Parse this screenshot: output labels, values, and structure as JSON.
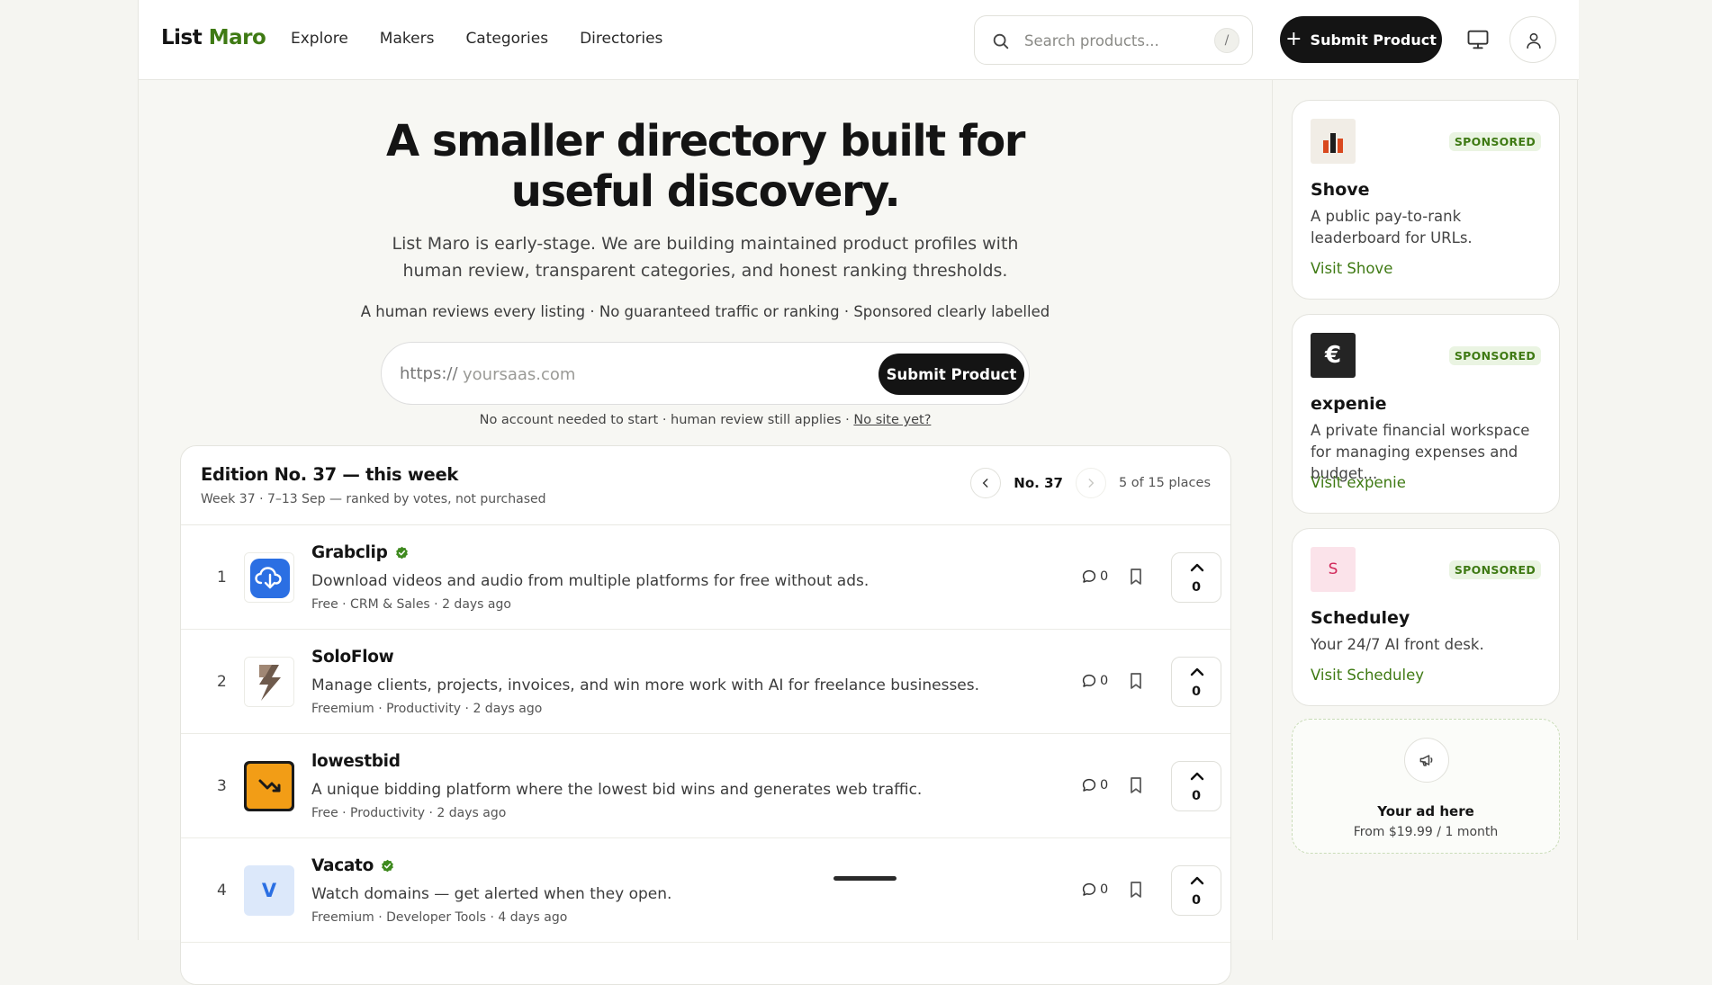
{
  "header": {
    "logo_part1": "List",
    "logo_part2": "Maro",
    "nav": [
      "Explore",
      "Makers",
      "Categories",
      "Directories"
    ],
    "search_placeholder": "Search products...",
    "search_shortcut": "/",
    "submit_label": "Submit Product"
  },
  "hero": {
    "title_line1": "A smaller directory built for",
    "title_line2": "useful discovery.",
    "description": "List Maro is early-stage. We are building maintained product profiles with human review, transparent categories, and honest ranking thresholds.",
    "tagline": "A human reviews every listing · No guaranteed traffic or ranking · Sponsored clearly labelled",
    "url_prefix": "https://",
    "url_placeholder": "yoursaas.com",
    "url_submit": "Submit Product",
    "note_text": "No account needed to start · human review still applies · ",
    "note_link": "No site yet?"
  },
  "edition": {
    "title": "Edition No. 37 — this week",
    "subtitle": "Week 37 · 7–13 Sep — ranked by votes, not purchased",
    "number": "No. 37",
    "places": "5 of 15 places",
    "prev": "‹",
    "next": "›"
  },
  "products": [
    {
      "rank": "1",
      "name": "Grabclip",
      "verified": true,
      "description": "Download videos and audio from multiple platforms for free without ads.",
      "meta": "Free · CRM & Sales · 2 days ago",
      "comments": "0",
      "votes": "0",
      "icon": "cloud-download-icon"
    },
    {
      "rank": "2",
      "name": "SoloFlow",
      "verified": false,
      "description": "Manage clients, projects, invoices, and win more work with AI for freelance businesses.",
      "meta": "Freemium · Productivity · 2 days ago",
      "comments": "0",
      "votes": "0",
      "icon": "soloflow-logo"
    },
    {
      "rank": "3",
      "name": "lowestbid",
      "verified": false,
      "description": "A unique bidding platform where the lowest bid wins and generates web traffic.",
      "meta": "Free · Productivity · 2 days ago",
      "comments": "0",
      "votes": "0",
      "icon": "trend-down-icon"
    },
    {
      "rank": "4",
      "name": "Vacato",
      "verified": true,
      "description": "Watch domains — get alerted when they open.",
      "meta": "Freemium · Developer Tools · 4 days ago",
      "comments": "0",
      "votes": "0",
      "icon": "letter-v",
      "icon_letter": "V"
    }
  ],
  "sponsors": [
    {
      "badge": "SPONSORED",
      "name": "Shove",
      "description": "A public pay-to-rank leaderboard for URLs.",
      "link": "Visit Shove"
    },
    {
      "badge": "SPONSORED",
      "name": "expenie",
      "description": "A private financial workspace for managing expenses and budget...",
      "link": "Visit expenie",
      "logo_letter": "€"
    },
    {
      "badge": "SPONSORED",
      "name": "Scheduley",
      "description": "Your 24/7 AI front desk.",
      "link": "Visit Scheduley",
      "logo_letter": "S"
    }
  ],
  "ad_slot": {
    "title": "Your ad here",
    "price": "From $19.99 / 1 month"
  },
  "colors": {
    "accent_green": "#3f7a14",
    "dark": "#141414",
    "background": "#f7f7f3"
  }
}
